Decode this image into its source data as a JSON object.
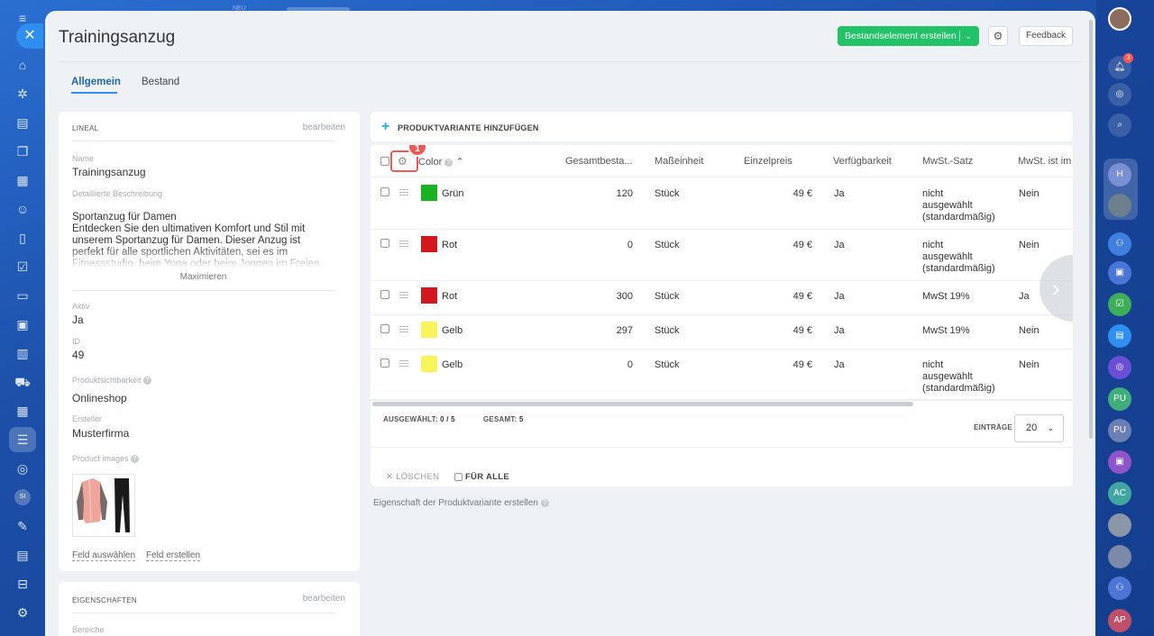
{
  "window": {
    "title": "Trainingsanzug",
    "top_new_label": "NEU"
  },
  "header": {
    "create_button": "Bestandselement erstellen",
    "feedback_button": "Feedback"
  },
  "tabs": [
    {
      "label": "Allgemein",
      "active": true
    },
    {
      "label": "Bestand",
      "active": false
    }
  ],
  "main_section": {
    "title": "LINEAL",
    "edit_label": "bearbeiten",
    "fields": {
      "name_label": "Name",
      "name_value": "Trainingsanzug",
      "desc_label": "Detaillierte Beschreibung",
      "desc_value": "Sportanzug für Damen\nEntdecken Sie den ultimativen Komfort und Stil mit unserem Sportanzug für Damen. Dieser Anzug ist perfekt für alle sportlichen Aktivitäten, sei es im Fitnessstudio, beim Yoga oder beim Joggen im Freien.",
      "maximize_label": "Maximieren",
      "active_label": "Aktiv",
      "active_value": "Ja",
      "id_label": "ID",
      "id_value": "49",
      "visibility_label": "Produktsichtbarkeit",
      "visibility_value": "Onlineshop",
      "creator_label": "Ersteller",
      "creator_value": "Musterfirma",
      "images_label": "Product images"
    },
    "select_field_link": "Feld auswählen",
    "create_field_link": "Feld erstellen"
  },
  "properties_section": {
    "title": "EIGENSCHAFTEN",
    "edit_label": "bearbeiten",
    "first_field_label": "Bereiche"
  },
  "variants": {
    "add_label": "PRODUKTVARIANTE HINZUFÜGEN",
    "step_marker": "1",
    "columns": [
      "Color",
      "Gesamtbesta...",
      "Maßeinheit",
      "Einzelpreis",
      "Verfügbarkeit",
      "MwSt.-Satz",
      "MwSt. ist im"
    ],
    "rows": [
      {
        "color_name": "Grün",
        "color_hex": "#19b321",
        "total": "120",
        "unit": "Stück",
        "price": "49 €",
        "available": "Ja",
        "vat_rate": [
          "nicht",
          "ausgewählt",
          "(standardmäßig)"
        ],
        "vat_included": "Nein"
      },
      {
        "color_name": "Rot",
        "color_hex": "#d3171d",
        "total": "0",
        "unit": "Stück",
        "price": "49 €",
        "available": "Ja",
        "vat_rate": [
          "nicht",
          "ausgewählt",
          "(standardmäßig)"
        ],
        "vat_included": "Nein"
      },
      {
        "color_name": "Rot",
        "color_hex": "#d3171d",
        "total": "300",
        "unit": "Stück",
        "price": "49 €",
        "available": "Ja",
        "vat_rate": [
          "MwSt 19%"
        ],
        "vat_included": "Ja"
      },
      {
        "color_name": "Gelb",
        "color_hex": "#f8f55a",
        "total": "297",
        "unit": "Stück",
        "price": "49 €",
        "available": "Ja",
        "vat_rate": [
          "MwSt 19%"
        ],
        "vat_included": "Nein"
      },
      {
        "color_name": "Gelb",
        "color_hex": "#f8f55a",
        "total": "0",
        "unit": "Stück",
        "price": "49 €",
        "available": "Ja",
        "vat_rate": [
          "nicht",
          "ausgewählt",
          "(standardmäßig)"
        ],
        "vat_included": "Nein"
      }
    ],
    "footer": {
      "selected_label": "AUSGEWÄHLT:",
      "selected_value": "0 / 5",
      "total_label": "GESAMT:",
      "total_value": "5",
      "entries_label": "EINTRÄGE",
      "entries_value": "20",
      "delete_label": "LÖSCHEN",
      "for_all_label": "FÜR ALLE"
    }
  },
  "create_property_link": "Eigenschaft der Produktvariante erstellen",
  "right_bar": {
    "notification_count": "3",
    "avatars": [
      "H",
      "PU",
      "PU",
      "AC",
      "AP"
    ]
  },
  "left_nav": {
    "si_label": "SI"
  }
}
